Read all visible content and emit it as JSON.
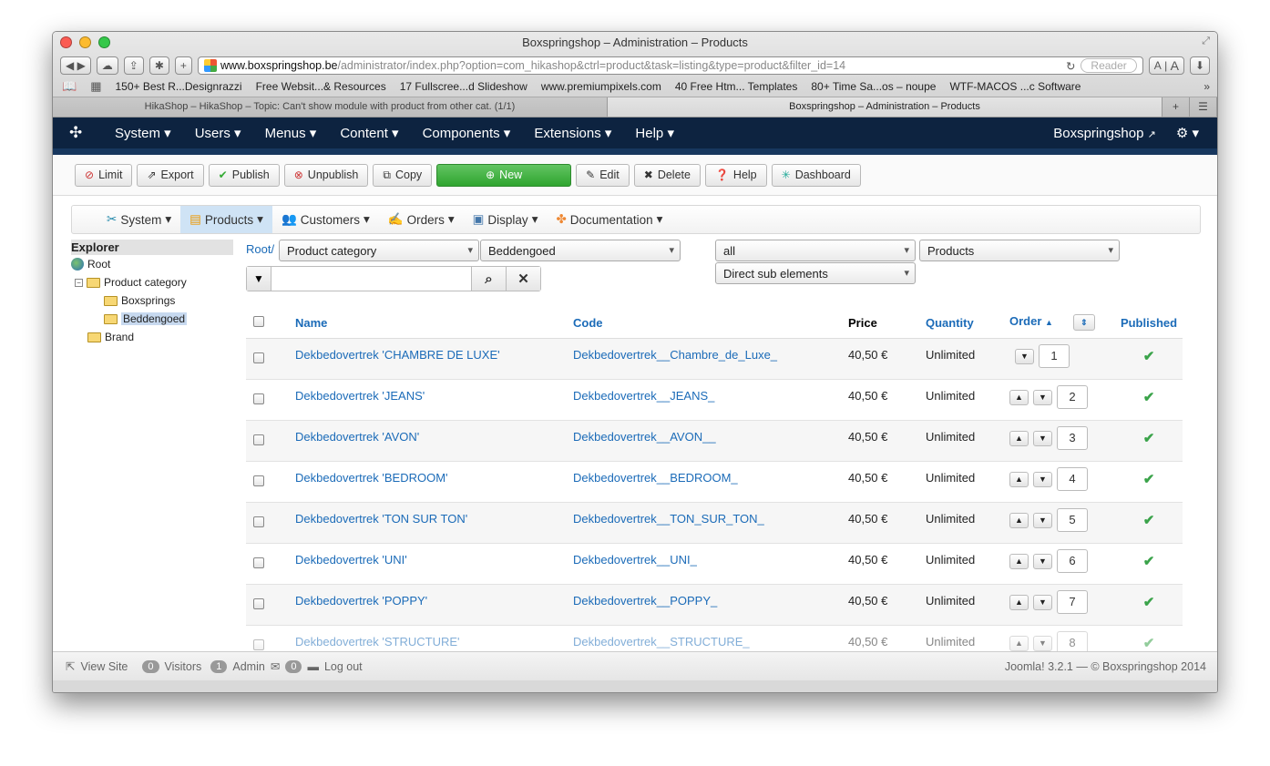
{
  "browser": {
    "window_title": "Boxspringshop – Administration – Products",
    "url_host": "www.boxspringshop.be",
    "url_path": "/administrator/index.php?option=com_hikashop&ctrl=product&task=listing&type=product&filter_id=14",
    "reader_label": "Reader",
    "font_small": "A",
    "font_large": "A",
    "bookmarks": [
      "150+ Best R...Designrazzi",
      "Free Websit...& Resources",
      "17 Fullscree...d Slideshow",
      "www.premiumpixels.com",
      "40 Free Htm... Templates",
      "80+ Time Sa...os – noupe",
      "WTF-MACOS ...c Software"
    ],
    "tabs": [
      "HikaShop – HikaShop – Topic: Can't show module with product from other cat. (1/1)",
      "Boxspringshop – Administration – Products"
    ]
  },
  "navbar": {
    "items": [
      "System",
      "Users",
      "Menus",
      "Content",
      "Components",
      "Extensions",
      "Help"
    ],
    "site_link": "Boxspringshop"
  },
  "toolbar": {
    "limit": "Limit",
    "export": "Export",
    "publish": "Publish",
    "unpublish": "Unpublish",
    "copy": "Copy",
    "new": "New",
    "edit": "Edit",
    "delete": "Delete",
    "help": "Help",
    "dashboard": "Dashboard"
  },
  "hikamenu": {
    "items": [
      "System",
      "Products",
      "Customers",
      "Orders",
      "Display",
      "Documentation"
    ]
  },
  "explorer": {
    "title": "Explorer",
    "root": "Root",
    "product_category": "Product category",
    "boxsprings": "Boxsprings",
    "beddengoed": "Beddengoed",
    "brand": "Brand"
  },
  "filters": {
    "root_link": "Root/",
    "category_type": "Product category",
    "category": "Beddengoed",
    "all": "all",
    "products": "Products",
    "sub_elements": "Direct sub elements",
    "search_value": ""
  },
  "grid": {
    "headers": {
      "name": "Name",
      "code": "Code",
      "price": "Price",
      "quantity": "Quantity",
      "order": "Order",
      "published": "Published"
    },
    "rows": [
      {
        "name": "Dekbedovertrek 'CHAMBRE DE LUXE'",
        "code": "Dekbedovertrek__Chambre_de_Luxe_",
        "price": "40,50 €",
        "qty": "Unlimited",
        "order": "1"
      },
      {
        "name": "Dekbedovertrek 'JEANS'",
        "code": "Dekbedovertrek__JEANS_",
        "price": "40,50 €",
        "qty": "Unlimited",
        "order": "2"
      },
      {
        "name": "Dekbedovertrek 'AVON'",
        "code": "Dekbedovertrek__AVON__",
        "price": "40,50 €",
        "qty": "Unlimited",
        "order": "3"
      },
      {
        "name": "Dekbedovertrek 'BEDROOM'",
        "code": "Dekbedovertrek__BEDROOM_",
        "price": "40,50 €",
        "qty": "Unlimited",
        "order": "4"
      },
      {
        "name": "Dekbedovertrek 'TON SUR TON'",
        "code": "Dekbedovertrek__TON_SUR_TON_",
        "price": "40,50 €",
        "qty": "Unlimited",
        "order": "5"
      },
      {
        "name": "Dekbedovertrek 'UNI'",
        "code": "Dekbedovertrek__UNI_",
        "price": "40,50 €",
        "qty": "Unlimited",
        "order": "6"
      },
      {
        "name": "Dekbedovertrek 'POPPY'",
        "code": "Dekbedovertrek__POPPY_",
        "price": "40,50 €",
        "qty": "Unlimited",
        "order": "7"
      },
      {
        "name": "Dekbedovertrek 'STRUCTURE'",
        "code": "Dekbedovertrek__STRUCTURE_",
        "price": "40,50 €",
        "qty": "Unlimited",
        "order": "8"
      }
    ]
  },
  "statusbar": {
    "view_site": "View Site",
    "visitors_count": "0",
    "visitors": "Visitors",
    "admin_count": "1",
    "admin": "Admin",
    "messages_count": "0",
    "logout": "Log out",
    "version": "Joomla! 3.2.1  —  © Boxspringshop 2014"
  }
}
